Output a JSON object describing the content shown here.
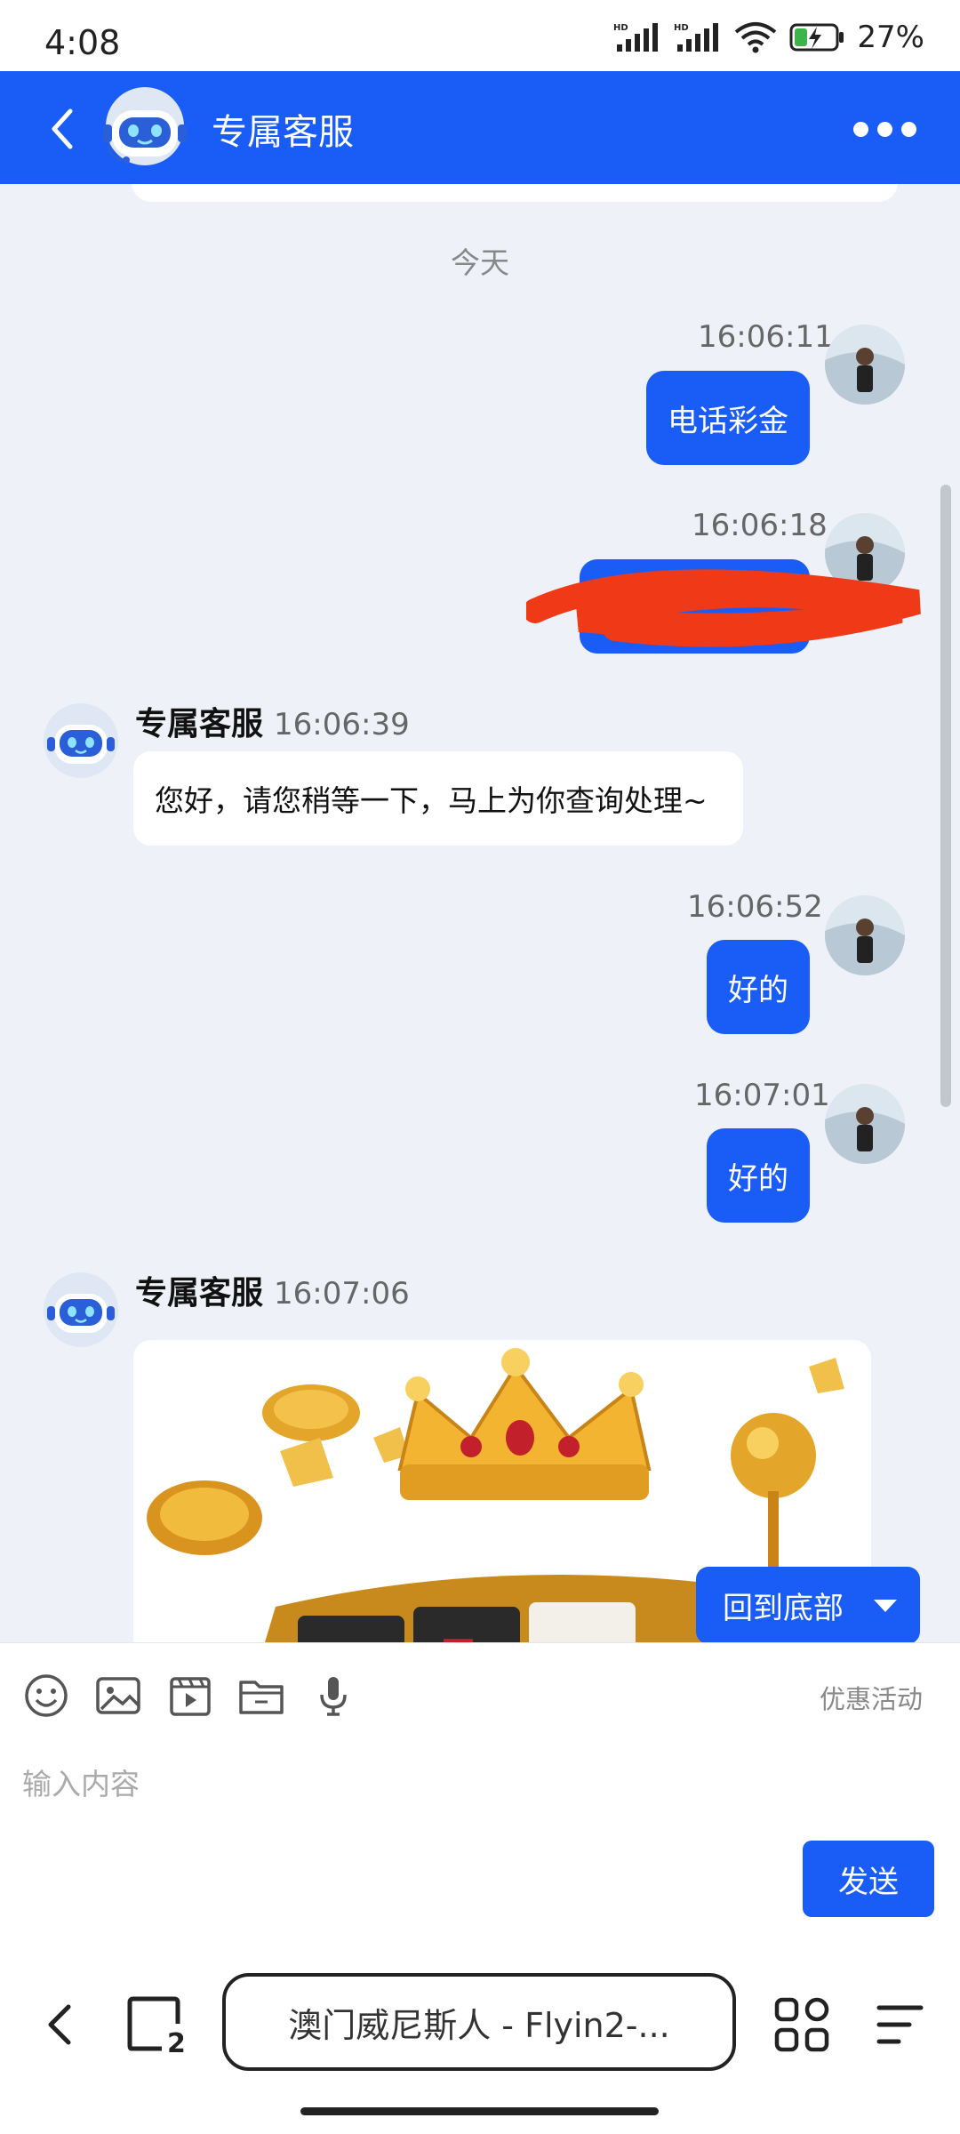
{
  "status": {
    "time": "4:08",
    "battery": "27%",
    "icons": [
      "hd-signal-icon",
      "hd-signal-icon",
      "wifi-icon",
      "battery-charging-icon"
    ]
  },
  "header": {
    "title": "专属客服",
    "back_icon": "chevron-left-icon",
    "more_icon": "more-dots-icon"
  },
  "chat": {
    "date_divider": "今天",
    "messages": [
      {
        "sender": "user",
        "time": "16:06:11",
        "text": "电话彩金"
      },
      {
        "sender": "user",
        "time": "16:06:18",
        "text": ""
      },
      {
        "sender": "agent",
        "name": "专属客服",
        "time": "16:06:39",
        "text": "您好，请您稍等一下，马上为你查询处理~"
      },
      {
        "sender": "user",
        "time": "16:06:52",
        "text": "好的"
      },
      {
        "sender": "user",
        "time": "16:07:01",
        "text": "好的"
      },
      {
        "sender": "agent",
        "name": "专属客服",
        "time": "16:07:06",
        "image": "slot-machine-crown-image"
      }
    ],
    "scroll_to_bottom": "回到底部"
  },
  "input": {
    "tools": [
      "emoji-icon",
      "image-icon",
      "video-icon",
      "folder-icon",
      "microphone-icon"
    ],
    "promo_link": "优惠活动",
    "placeholder": "输入内容",
    "send_label": "发送"
  },
  "browser": {
    "url_text": "澳门威尼斯人 - Flyin2-..."
  },
  "colors": {
    "primary": "#1a5cf6",
    "chat_bg": "#eef2f8",
    "redaction": "#f03a17"
  }
}
